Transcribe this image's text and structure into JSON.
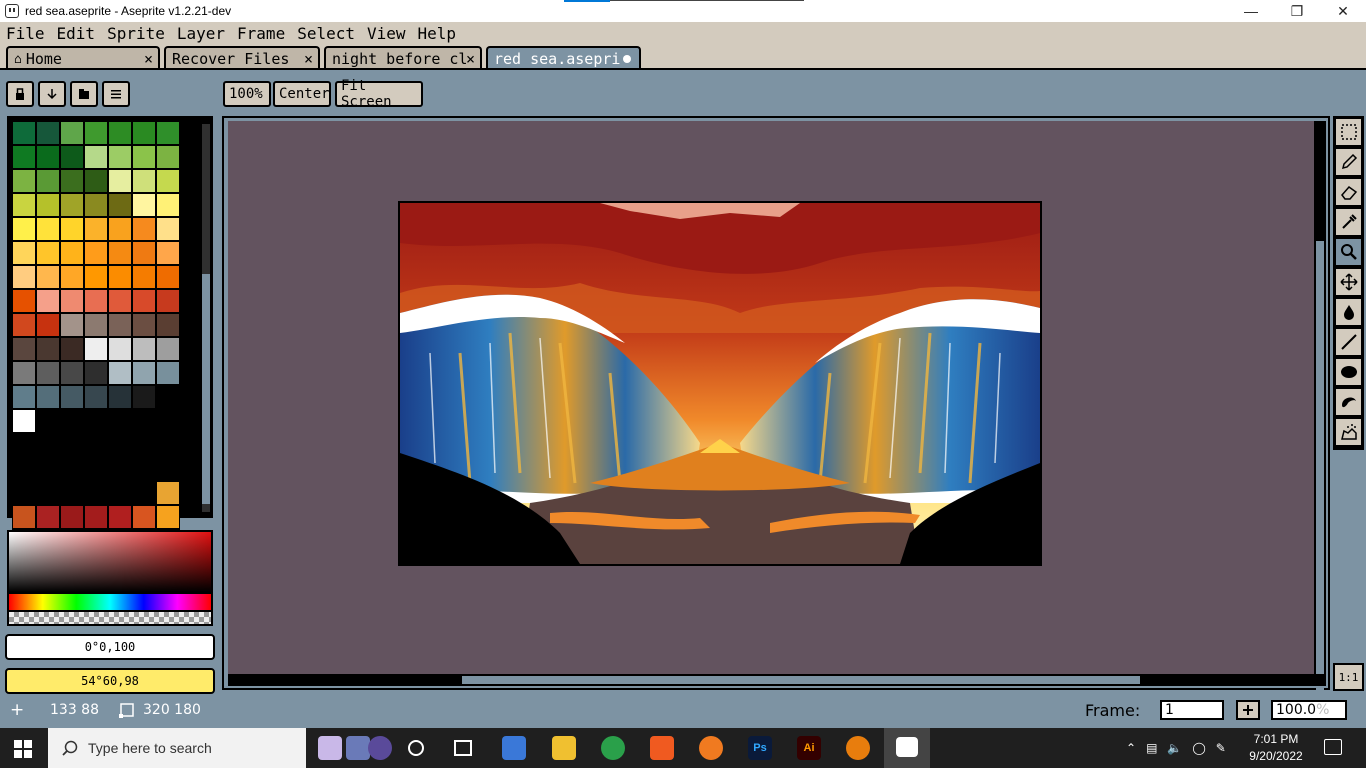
{
  "window": {
    "title": "red sea.aseprite - Aseprite v1.2.21-dev"
  },
  "menu": [
    "File",
    "Edit",
    "Sprite",
    "Layer",
    "Frame",
    "Select",
    "View",
    "Help"
  ],
  "tabs": [
    {
      "label": "Home",
      "close": "×"
    },
    {
      "label": "Recover Files",
      "close": "×"
    },
    {
      "label": "night before cl",
      "close": "×"
    },
    {
      "label": "red sea.asepri"
    }
  ],
  "zoom_buttons": {
    "b100": "100%",
    "center": "Center",
    "fit": "Fit Screen"
  },
  "palette_colors": [
    "#0e6b3a",
    "#16573a",
    "#5fa64a",
    "#3f9a2e",
    "#2d8c24",
    "#2a8a22",
    "#2f8f2a",
    "#0f7a22",
    "#0a6b1c",
    "#0d5a1a",
    "#b5d98a",
    "#9ccc65",
    "#8bc34a",
    "#7cb342",
    "#7cb342",
    "#5a9a35",
    "#3b6e1e",
    "#2e5c16",
    "#e6eea0",
    "#cfe07a",
    "#c5d94e",
    "#c9d440",
    "#b5c12a",
    "#a0a428",
    "#8a8a20",
    "#6d6a14",
    "#fff5a0",
    "#fff176",
    "#fff04a",
    "#ffe23a",
    "#ffd42a",
    "#fbb22a",
    "#f9a21e",
    "#f68a1e",
    "#ffe08a",
    "#ffd55a",
    "#ffc52a",
    "#ffb31a",
    "#ff9c1a",
    "#f58a12",
    "#ef7a12",
    "#ffa64a",
    "#ffcc80",
    "#ffb74d",
    "#ffa726",
    "#ff9800",
    "#fb8c00",
    "#f57c00",
    "#ef6c00",
    "#e65100",
    "#f5a08a",
    "#ef8a70",
    "#e86e52",
    "#e05a3a",
    "#d84a2a",
    "#c73a1e",
    "#d1481e",
    "#c7320f",
    "#a3938a",
    "#8c7a70",
    "#7a6258",
    "#6b4e42",
    "#5a3e32",
    "#5a463e",
    "#4a3830",
    "#3b2a24",
    "#eeeeee",
    "#dedede",
    "#bdbdbd",
    "#9e9e9e",
    "#7a7a7a",
    "#5e5e5e",
    "#484848",
    "#2e2e2e",
    "#b0bec5",
    "#90a4ae",
    "#78909c",
    "#607d8b",
    "#546e7a",
    "#455a64",
    "#37474f",
    "#263238",
    "#1a1a1a",
    "#000000",
    "#ffffff",
    "#000000",
    "#000000",
    "#000000",
    "#000000",
    "#000000",
    "#000000",
    "#000000",
    "#000000",
    "#000000",
    "#000000",
    "#000000",
    "#000000",
    "#000000",
    "#000000",
    "#000000",
    "#000000",
    "#000000",
    "#000000",
    "#000000",
    "#000000",
    "#000000",
    "#000000",
    "#000000",
    "#000000",
    "#000000",
    "#000000",
    "#e8a432",
    "#c8541e",
    "#aa2222",
    "#9a1a1a",
    "#a31c1c",
    "#b01f1f",
    "#d85520",
    "#f6a21e",
    "#f0a028",
    "#ffe05a",
    "#ffe85a",
    "#fdeb6a",
    "#f6b06a",
    "#e8a89a",
    "#fff176",
    "#fff59d",
    "#1a1a4a",
    "#000000",
    "#000000",
    "#000000",
    "#000000"
  ],
  "colors": {
    "fg_label": "0°0,100",
    "bg_label": "54°60,98",
    "fg_bg": "#ffffff",
    "bg_bg": "#ffeb6a"
  },
  "status": {
    "cursor_xy": "133 88",
    "sprite_size": "320 180",
    "frame_label": "Frame:",
    "frame_value": "1",
    "zoom_value": "100.0",
    "zoom_unit": "%"
  },
  "one_to_one": "1:1",
  "taskbar": {
    "search_placeholder": "Type here to search",
    "time": "7:01 PM",
    "date": "9/20/2022"
  }
}
